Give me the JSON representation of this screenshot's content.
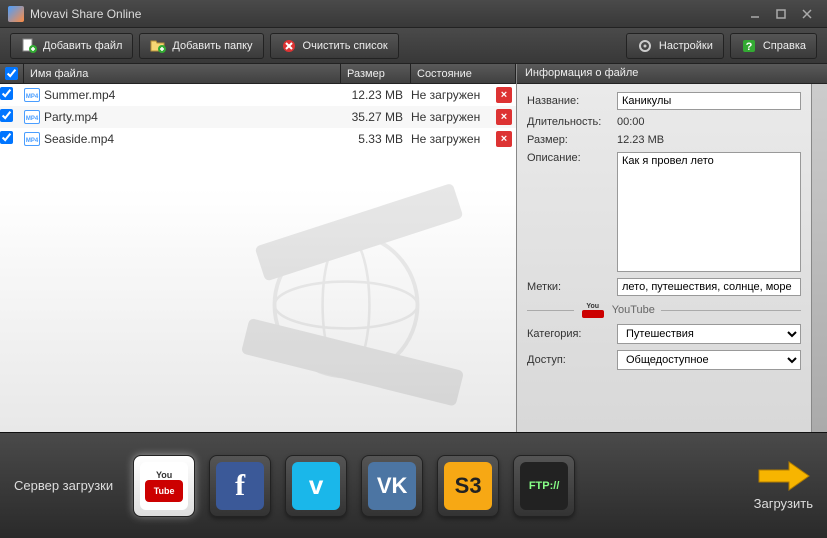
{
  "title": "Movavi Share Online",
  "toolbar": {
    "add_file": "Добавить файл",
    "add_folder": "Добавить папку",
    "clear_list": "Очистить список",
    "settings": "Настройки",
    "help": "Справка"
  },
  "columns": {
    "name": "Имя файла",
    "size": "Размер",
    "status": "Состояние"
  },
  "files": [
    {
      "name": "Summer.mp4",
      "size": "12.23 MB",
      "status": "Не загружен",
      "checked": true
    },
    {
      "name": "Party.mp4",
      "size": "35.27 MB",
      "status": "Не загружен",
      "checked": true
    },
    {
      "name": "Seaside.mp4",
      "size": "5.33 MB",
      "status": "Не загружен",
      "checked": true
    }
  ],
  "info": {
    "header": "Информация о файле",
    "labels": {
      "title": "Название:",
      "duration": "Длительность:",
      "size": "Размер:",
      "description": "Описание:",
      "tags": "Метки:",
      "category": "Категория:",
      "access": "Доступ:"
    },
    "values": {
      "title": "Каникулы",
      "duration": "00:00",
      "size": "12.23 MB",
      "description": "Как я провел лето",
      "tags": "лето, путешествия, солнце, море",
      "category": "Путешествия",
      "access": "Общедоступное"
    },
    "section": "YouTube"
  },
  "bottom": {
    "server_label": "Сервер загрузки",
    "upload": "Загрузить"
  },
  "servers": {
    "youtube_top": "You",
    "youtube_tube": "Tube",
    "fb": "f",
    "vimeo": "v",
    "vk": "VK",
    "s3": "S3",
    "ftp": "FTP://"
  }
}
